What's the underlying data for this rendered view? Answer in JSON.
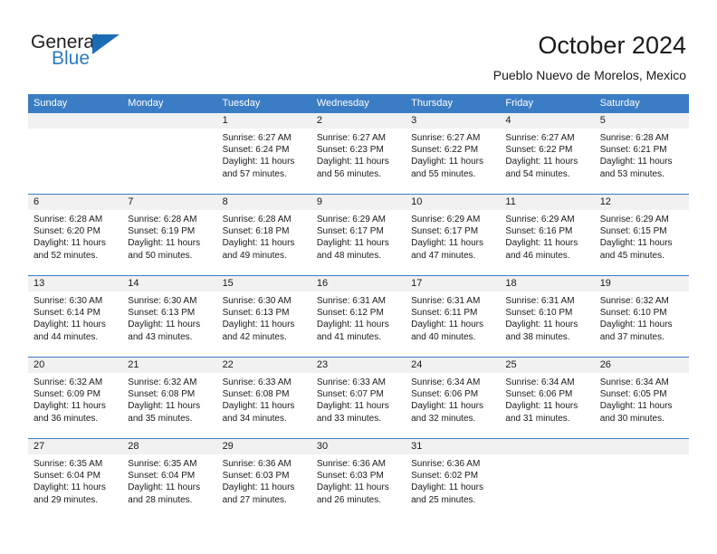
{
  "logo": {
    "word_top": "General",
    "word_bottom": "Blue",
    "triangle_color": "#1c6cb5",
    "blue_text_color": "#2b7cc0"
  },
  "header": {
    "title": "October 2024",
    "subtitle": "Pueblo Nuevo de Morelos, Mexico"
  },
  "theme": {
    "header_blue": "#3b7dc4",
    "day_band_gray": "#f1f1f1"
  },
  "weekdays": [
    "Sunday",
    "Monday",
    "Tuesday",
    "Wednesday",
    "Thursday",
    "Friday",
    "Saturday"
  ],
  "weeks": [
    [
      {
        "day": "",
        "empty": true,
        "lines": []
      },
      {
        "day": "",
        "empty": true,
        "lines": []
      },
      {
        "day": "1",
        "lines": [
          "Sunrise: 6:27 AM",
          "Sunset: 6:24 PM",
          "Daylight: 11 hours",
          "and 57 minutes."
        ]
      },
      {
        "day": "2",
        "lines": [
          "Sunrise: 6:27 AM",
          "Sunset: 6:23 PM",
          "Daylight: 11 hours",
          "and 56 minutes."
        ]
      },
      {
        "day": "3",
        "lines": [
          "Sunrise: 6:27 AM",
          "Sunset: 6:22 PM",
          "Daylight: 11 hours",
          "and 55 minutes."
        ]
      },
      {
        "day": "4",
        "lines": [
          "Sunrise: 6:27 AM",
          "Sunset: 6:22 PM",
          "Daylight: 11 hours",
          "and 54 minutes."
        ]
      },
      {
        "day": "5",
        "lines": [
          "Sunrise: 6:28 AM",
          "Sunset: 6:21 PM",
          "Daylight: 11 hours",
          "and 53 minutes."
        ]
      }
    ],
    [
      {
        "day": "6",
        "lines": [
          "Sunrise: 6:28 AM",
          "Sunset: 6:20 PM",
          "Daylight: 11 hours",
          "and 52 minutes."
        ]
      },
      {
        "day": "7",
        "lines": [
          "Sunrise: 6:28 AM",
          "Sunset: 6:19 PM",
          "Daylight: 11 hours",
          "and 50 minutes."
        ]
      },
      {
        "day": "8",
        "lines": [
          "Sunrise: 6:28 AM",
          "Sunset: 6:18 PM",
          "Daylight: 11 hours",
          "and 49 minutes."
        ]
      },
      {
        "day": "9",
        "lines": [
          "Sunrise: 6:29 AM",
          "Sunset: 6:17 PM",
          "Daylight: 11 hours",
          "and 48 minutes."
        ]
      },
      {
        "day": "10",
        "lines": [
          "Sunrise: 6:29 AM",
          "Sunset: 6:17 PM",
          "Daylight: 11 hours",
          "and 47 minutes."
        ]
      },
      {
        "day": "11",
        "lines": [
          "Sunrise: 6:29 AM",
          "Sunset: 6:16 PM",
          "Daylight: 11 hours",
          "and 46 minutes."
        ]
      },
      {
        "day": "12",
        "lines": [
          "Sunrise: 6:29 AM",
          "Sunset: 6:15 PM",
          "Daylight: 11 hours",
          "and 45 minutes."
        ]
      }
    ],
    [
      {
        "day": "13",
        "lines": [
          "Sunrise: 6:30 AM",
          "Sunset: 6:14 PM",
          "Daylight: 11 hours",
          "and 44 minutes."
        ]
      },
      {
        "day": "14",
        "lines": [
          "Sunrise: 6:30 AM",
          "Sunset: 6:13 PM",
          "Daylight: 11 hours",
          "and 43 minutes."
        ]
      },
      {
        "day": "15",
        "lines": [
          "Sunrise: 6:30 AM",
          "Sunset: 6:13 PM",
          "Daylight: 11 hours",
          "and 42 minutes."
        ]
      },
      {
        "day": "16",
        "lines": [
          "Sunrise: 6:31 AM",
          "Sunset: 6:12 PM",
          "Daylight: 11 hours",
          "and 41 minutes."
        ]
      },
      {
        "day": "17",
        "lines": [
          "Sunrise: 6:31 AM",
          "Sunset: 6:11 PM",
          "Daylight: 11 hours",
          "and 40 minutes."
        ]
      },
      {
        "day": "18",
        "lines": [
          "Sunrise: 6:31 AM",
          "Sunset: 6:10 PM",
          "Daylight: 11 hours",
          "and 38 minutes."
        ]
      },
      {
        "day": "19",
        "lines": [
          "Sunrise: 6:32 AM",
          "Sunset: 6:10 PM",
          "Daylight: 11 hours",
          "and 37 minutes."
        ]
      }
    ],
    [
      {
        "day": "20",
        "lines": [
          "Sunrise: 6:32 AM",
          "Sunset: 6:09 PM",
          "Daylight: 11 hours",
          "and 36 minutes."
        ]
      },
      {
        "day": "21",
        "lines": [
          "Sunrise: 6:32 AM",
          "Sunset: 6:08 PM",
          "Daylight: 11 hours",
          "and 35 minutes."
        ]
      },
      {
        "day": "22",
        "lines": [
          "Sunrise: 6:33 AM",
          "Sunset: 6:08 PM",
          "Daylight: 11 hours",
          "and 34 minutes."
        ]
      },
      {
        "day": "23",
        "lines": [
          "Sunrise: 6:33 AM",
          "Sunset: 6:07 PM",
          "Daylight: 11 hours",
          "and 33 minutes."
        ]
      },
      {
        "day": "24",
        "lines": [
          "Sunrise: 6:34 AM",
          "Sunset: 6:06 PM",
          "Daylight: 11 hours",
          "and 32 minutes."
        ]
      },
      {
        "day": "25",
        "lines": [
          "Sunrise: 6:34 AM",
          "Sunset: 6:06 PM",
          "Daylight: 11 hours",
          "and 31 minutes."
        ]
      },
      {
        "day": "26",
        "lines": [
          "Sunrise: 6:34 AM",
          "Sunset: 6:05 PM",
          "Daylight: 11 hours",
          "and 30 minutes."
        ]
      }
    ],
    [
      {
        "day": "27",
        "lines": [
          "Sunrise: 6:35 AM",
          "Sunset: 6:04 PM",
          "Daylight: 11 hours",
          "and 29 minutes."
        ]
      },
      {
        "day": "28",
        "lines": [
          "Sunrise: 6:35 AM",
          "Sunset: 6:04 PM",
          "Daylight: 11 hours",
          "and 28 minutes."
        ]
      },
      {
        "day": "29",
        "lines": [
          "Sunrise: 6:36 AM",
          "Sunset: 6:03 PM",
          "Daylight: 11 hours",
          "and 27 minutes."
        ]
      },
      {
        "day": "30",
        "lines": [
          "Sunrise: 6:36 AM",
          "Sunset: 6:03 PM",
          "Daylight: 11 hours",
          "and 26 minutes."
        ]
      },
      {
        "day": "31",
        "lines": [
          "Sunrise: 6:36 AM",
          "Sunset: 6:02 PM",
          "Daylight: 11 hours",
          "and 25 minutes."
        ]
      },
      {
        "day": "",
        "empty": true,
        "lines": []
      },
      {
        "day": "",
        "empty": true,
        "lines": []
      }
    ]
  ]
}
